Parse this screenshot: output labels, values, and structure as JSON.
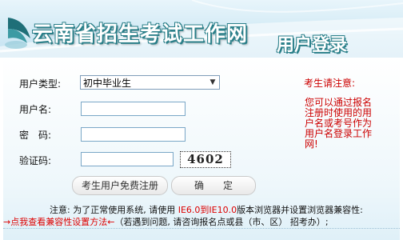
{
  "header": {
    "site_title": "云南省招生考试工作网",
    "page_title": "用户登录"
  },
  "form": {
    "user_type_label": "用户类型:",
    "user_type_selected": "初中毕业生",
    "username_label": "用户名:",
    "password_label": "密　码:",
    "captcha_label": "验证码:",
    "captcha_text": "4602",
    "register_button": "考生用户免费注册",
    "confirm_button": "确　　定"
  },
  "notice": {
    "title": "考生请注意:",
    "body": "您可以通过报名注册时使用的用户名或考号作为用户名登录工作网!"
  },
  "footer": {
    "line1_prefix": "注意: 为了正常使用系统, 请使用 ",
    "line1_highlight": "IE6.0到IE10.0",
    "line1_suffix": "版本浏览器并设置浏览器兼容性:",
    "line2_link": "→点我查看兼容性设置方法←",
    "line2_suffix": "（若遇到问题, 请咨询报名点或县（市、区） 招考办）;"
  },
  "colors": {
    "accent_teal": "#2a7f89",
    "notice_red": "#cc0000",
    "banner_bg": "#d6ecf6"
  }
}
